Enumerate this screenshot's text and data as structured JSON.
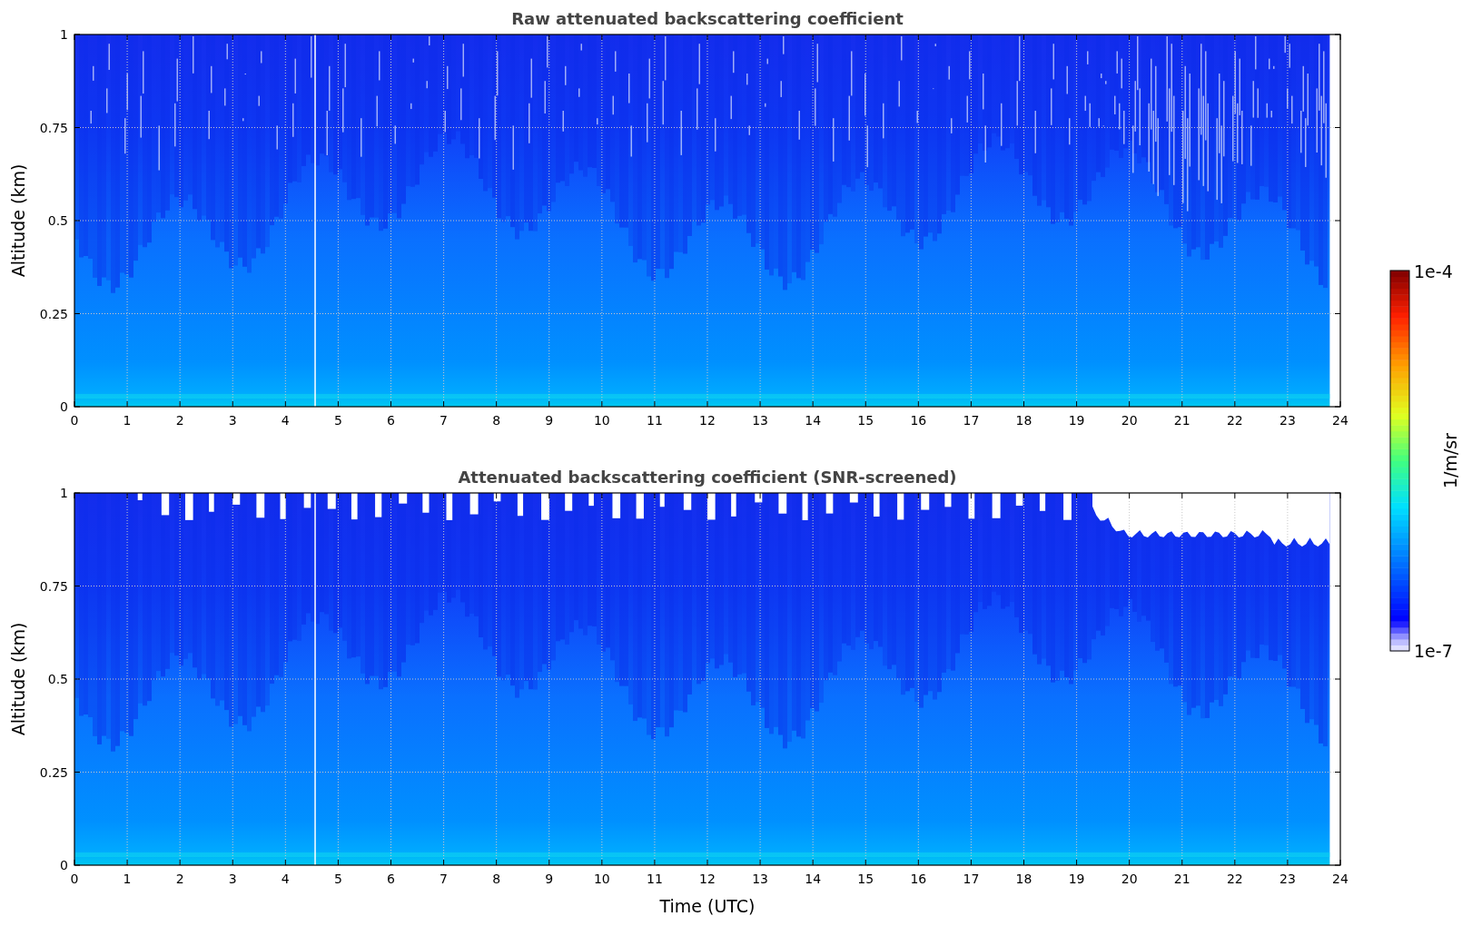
{
  "panels": [
    {
      "title": "Raw attenuated backscattering coefficient",
      "ylabel": "Altitude (km)",
      "yticks": [
        "1",
        "0.75",
        "0.5",
        "0.25",
        "0"
      ],
      "xticks": [
        "0",
        "1",
        "2",
        "3",
        "4",
        "5",
        "6",
        "7",
        "8",
        "9",
        "10",
        "11",
        "12",
        "13",
        "14",
        "15",
        "16",
        "17",
        "18",
        "19",
        "20",
        "21",
        "22",
        "23",
        "24"
      ],
      "kind": "raw"
    },
    {
      "title": "Attenuated backscattering coefficient (SNR-screened)",
      "ylabel": "Altitude (km)",
      "yticks": [
        "1",
        "0.75",
        "0.5",
        "0.25",
        "0"
      ],
      "xticks": [
        "0",
        "1",
        "2",
        "3",
        "4",
        "5",
        "6",
        "7",
        "8",
        "9",
        "10",
        "11",
        "12",
        "13",
        "14",
        "15",
        "16",
        "17",
        "18",
        "19",
        "20",
        "21",
        "22",
        "23",
        "24"
      ],
      "kind": "screened"
    }
  ],
  "xlabel": "Time (UTC)",
  "colorbar": {
    "label": "1/m/sr",
    "max": "1e-4",
    "min": "1e-7"
  }
}
